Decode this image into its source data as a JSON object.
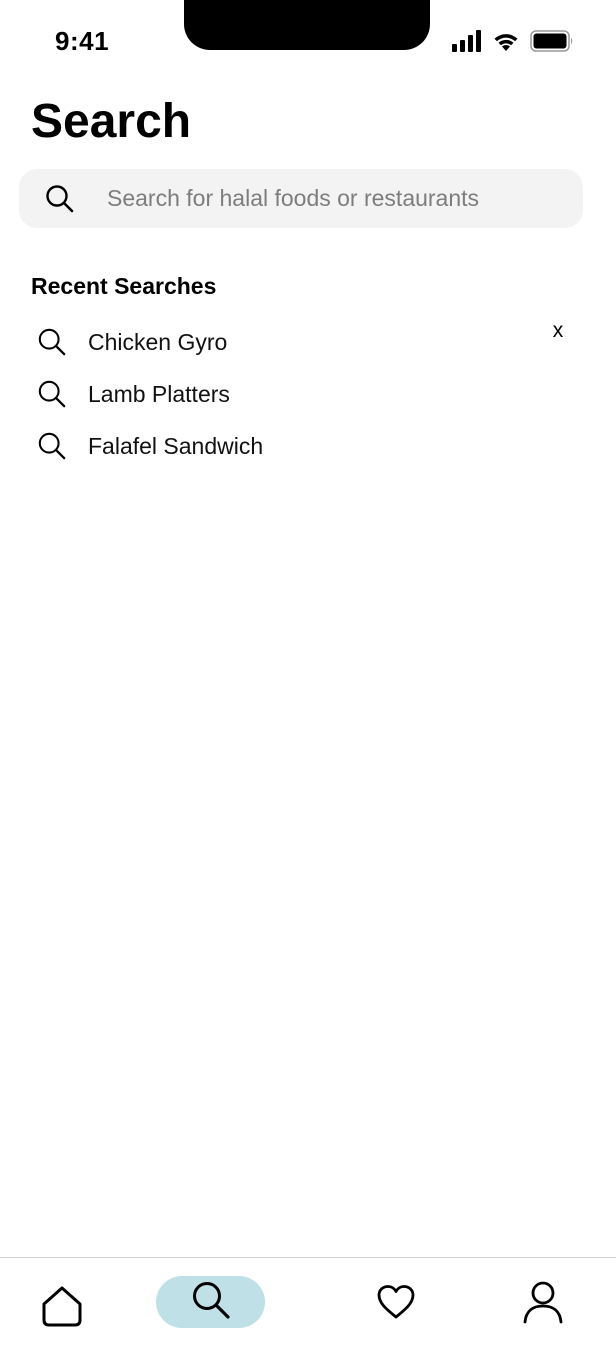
{
  "status_bar": {
    "time": "9:41",
    "icons": [
      "cellular-signal-icon",
      "wifi-icon",
      "battery-icon"
    ]
  },
  "page": {
    "title": "Search"
  },
  "search": {
    "placeholder": "Search for halal foods or restaurants",
    "value": "",
    "icon": "search-icon"
  },
  "recent": {
    "heading": "Recent Searches",
    "clear_label": "x",
    "items": [
      {
        "label": "Chicken Gyro",
        "icon": "search-icon"
      },
      {
        "label": "Lamb Platters",
        "icon": "search-icon"
      },
      {
        "label": "Falafel Sandwich",
        "icon": "search-icon"
      }
    ]
  },
  "tab_bar": {
    "active": "search",
    "active_color": "#bfe0e6",
    "tabs": [
      {
        "id": "home",
        "icon": "home-icon"
      },
      {
        "id": "search",
        "icon": "search-icon"
      },
      {
        "id": "favorites",
        "icon": "heart-icon"
      },
      {
        "id": "profile",
        "icon": "user-icon"
      }
    ]
  }
}
